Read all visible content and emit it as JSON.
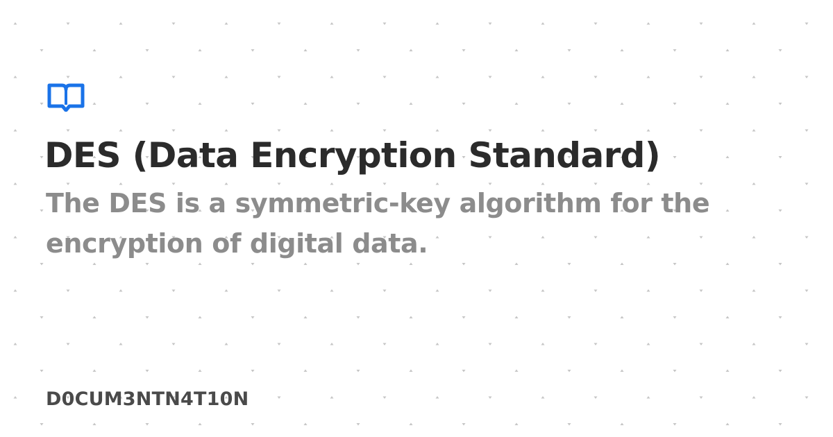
{
  "colors": {
    "background": "#ffffff",
    "accent": "#1a73e8",
    "title": "#2b2b2b",
    "description": "#8c8c8c",
    "footer": "#4a4a4a",
    "dots": "#c6c6c6"
  },
  "logo": {
    "icon": "open-book-icon"
  },
  "title": "DES (Data Encryption Standard)",
  "description": "The DES is a symmetric-key algorithm for the encryption of digital data.",
  "footer": "D0CUM3NTN4T10N"
}
